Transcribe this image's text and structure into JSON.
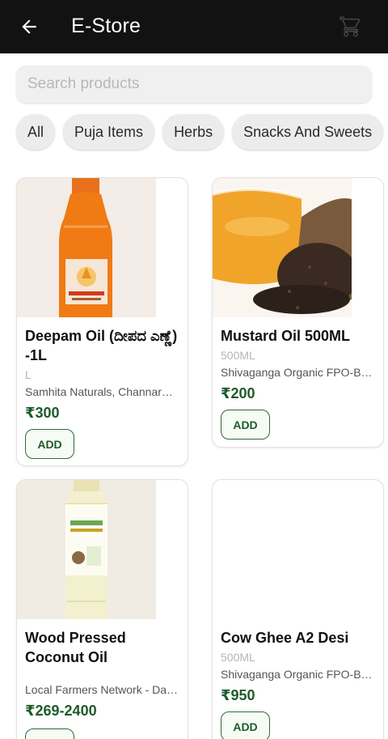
{
  "appbar": {
    "title": "E-Store",
    "back_icon": "arrow-back-icon",
    "cart_icon": "cart-icon"
  },
  "search": {
    "placeholder": "Search products",
    "value": ""
  },
  "categories": [
    "All",
    "Puja Items",
    "Herbs",
    "Snacks And Sweets"
  ],
  "products": [
    {
      "name": "Deepam Oil (ದೀಪದ ಎಣ್ಣೆ) -1L",
      "unit": "L",
      "seller": "Samhita Naturals, Channarayapatna",
      "price": "₹300",
      "action": "ADD"
    },
    {
      "name": "Mustard Oil 500ML",
      "unit": "500ML",
      "seller": "Shivaganga Organic FPO-Bangalore",
      "price": "₹200",
      "action": "ADD"
    },
    {
      "name": "Wood Pressed Coconut Oil",
      "unit": "",
      "seller": "Local Farmers Network - Dakshina Kannada",
      "price": "₹269-2400",
      "action": "ADD"
    },
    {
      "name": "Cow Ghee A2 Desi",
      "unit": "500ML",
      "seller": "Shivaganga Organic FPO-Bangalore",
      "price": "₹950",
      "action": "ADD"
    }
  ],
  "colors": {
    "appbar": "#121212",
    "price": "#1e5b2a",
    "accent_border": "#2e6b3a"
  }
}
